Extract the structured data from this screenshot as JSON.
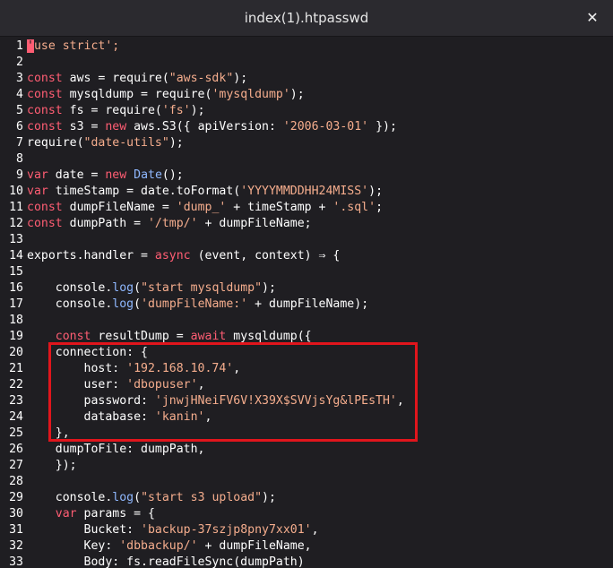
{
  "window": {
    "title": "index(1).htpasswd",
    "close_icon": "✕"
  },
  "editor": {
    "lines": [
      {
        "n": "1",
        "t": [
          [
            "cur",
            "'"
          ],
          [
            "str",
            "use strict';"
          ]
        ]
      },
      {
        "n": "2",
        "t": []
      },
      {
        "n": "3",
        "t": [
          [
            "kw",
            "const"
          ],
          [
            "",
            " aws = require("
          ],
          [
            "str",
            "\"aws-sdk\""
          ],
          [
            "",
            ");"
          ]
        ]
      },
      {
        "n": "4",
        "t": [
          [
            "kw",
            "const"
          ],
          [
            "",
            " mysqldump = require("
          ],
          [
            "str",
            "'mysqldump'"
          ],
          [
            "",
            ");"
          ]
        ]
      },
      {
        "n": "5",
        "t": [
          [
            "kw",
            "const"
          ],
          [
            "",
            " fs = require("
          ],
          [
            "str",
            "'fs'"
          ],
          [
            "",
            ");"
          ]
        ]
      },
      {
        "n": "6",
        "t": [
          [
            "kw",
            "const"
          ],
          [
            "",
            " s3 = "
          ],
          [
            "kw",
            "new"
          ],
          [
            "",
            " aws.S3({ apiVersion: "
          ],
          [
            "str",
            "'2006-03-01'"
          ],
          [
            "",
            " });"
          ]
        ]
      },
      {
        "n": "7",
        "t": [
          [
            "",
            "require("
          ],
          [
            "str",
            "\"date-utils\""
          ],
          [
            "",
            ");"
          ]
        ]
      },
      {
        "n": "8",
        "t": []
      },
      {
        "n": "9",
        "t": [
          [
            "kw",
            "var"
          ],
          [
            "",
            " date = "
          ],
          [
            "kw",
            "new"
          ],
          [
            "",
            " "
          ],
          [
            "fn",
            "Date"
          ],
          [
            "",
            "();"
          ]
        ]
      },
      {
        "n": "10",
        "t": [
          [
            "kw",
            "var"
          ],
          [
            "",
            " timeStamp = date.toFormat("
          ],
          [
            "str",
            "'YYYYMMDDHH24MISS'"
          ],
          [
            "",
            ");"
          ]
        ]
      },
      {
        "n": "11",
        "t": [
          [
            "kw",
            "const"
          ],
          [
            "",
            " dumpFileName = "
          ],
          [
            "str",
            "'dump_'"
          ],
          [
            "",
            " + timeStamp + "
          ],
          [
            "str",
            "'.sql'"
          ],
          [
            "",
            ";"
          ]
        ]
      },
      {
        "n": "12",
        "t": [
          [
            "kw",
            "const"
          ],
          [
            "",
            " dumpPath = "
          ],
          [
            "str",
            "'/tmp/'"
          ],
          [
            "",
            " + dumpFileName;"
          ]
        ]
      },
      {
        "n": "13",
        "t": []
      },
      {
        "n": "14",
        "t": [
          [
            "",
            "exports.handler = "
          ],
          [
            "kw",
            "async"
          ],
          [
            "",
            " (event, context) ⇒ {"
          ]
        ]
      },
      {
        "n": "15",
        "t": []
      },
      {
        "n": "16",
        "t": [
          [
            "",
            "    console."
          ],
          [
            "fn",
            "log"
          ],
          [
            "",
            "("
          ],
          [
            "str",
            "\"start mysqldump\""
          ],
          [
            "",
            ");"
          ]
        ]
      },
      {
        "n": "17",
        "t": [
          [
            "",
            "    console."
          ],
          [
            "fn",
            "log"
          ],
          [
            "",
            "("
          ],
          [
            "str",
            "'dumpFileName:'"
          ],
          [
            "",
            " + dumpFileName);"
          ]
        ]
      },
      {
        "n": "18",
        "t": []
      },
      {
        "n": "19",
        "t": [
          [
            "",
            "    "
          ],
          [
            "kw",
            "const"
          ],
          [
            "",
            " resultDump = "
          ],
          [
            "kw",
            "await"
          ],
          [
            "",
            " mysqldump({"
          ]
        ]
      },
      {
        "n": "20",
        "t": [
          [
            "",
            "    connection: {"
          ]
        ]
      },
      {
        "n": "21",
        "t": [
          [
            "",
            "        host: "
          ],
          [
            "str",
            "'192.168.10.74'"
          ],
          [
            "",
            ","
          ]
        ]
      },
      {
        "n": "22",
        "t": [
          [
            "",
            "        user: "
          ],
          [
            "str",
            "'dbopuser'"
          ],
          [
            "",
            ","
          ]
        ]
      },
      {
        "n": "23",
        "t": [
          [
            "",
            "        password: "
          ],
          [
            "str",
            "'jnwjHNeiFV6V!X39X$SVVjsYg&lPEsTH'"
          ],
          [
            "",
            ","
          ]
        ]
      },
      {
        "n": "24",
        "t": [
          [
            "",
            "        database: "
          ],
          [
            "str",
            "'kanin'"
          ],
          [
            "",
            ","
          ]
        ]
      },
      {
        "n": "25",
        "t": [
          [
            "",
            "    },"
          ]
        ]
      },
      {
        "n": "26",
        "t": [
          [
            "",
            "    dumpToFile: dumpPath,"
          ]
        ]
      },
      {
        "n": "27",
        "t": [
          [
            "",
            "    });"
          ]
        ]
      },
      {
        "n": "28",
        "t": []
      },
      {
        "n": "29",
        "t": [
          [
            "",
            "    console."
          ],
          [
            "fn",
            "log"
          ],
          [
            "",
            "("
          ],
          [
            "str",
            "\"start s3 upload\""
          ],
          [
            "",
            ");"
          ]
        ]
      },
      {
        "n": "30",
        "t": [
          [
            "",
            "    "
          ],
          [
            "kw",
            "var"
          ],
          [
            "",
            " params = {"
          ]
        ]
      },
      {
        "n": "31",
        "t": [
          [
            "",
            "        Bucket: "
          ],
          [
            "str",
            "'backup-37szjp8pny7xx01'"
          ],
          [
            "",
            ","
          ]
        ]
      },
      {
        "n": "32",
        "t": [
          [
            "",
            "        Key: "
          ],
          [
            "str",
            "'dbbackup/'"
          ],
          [
            "",
            " + dumpFileName,"
          ]
        ]
      },
      {
        "n": "33",
        "t": [
          [
            "",
            "        Body: fs.readFileSync(dumpPath)"
          ]
        ]
      }
    ]
  }
}
